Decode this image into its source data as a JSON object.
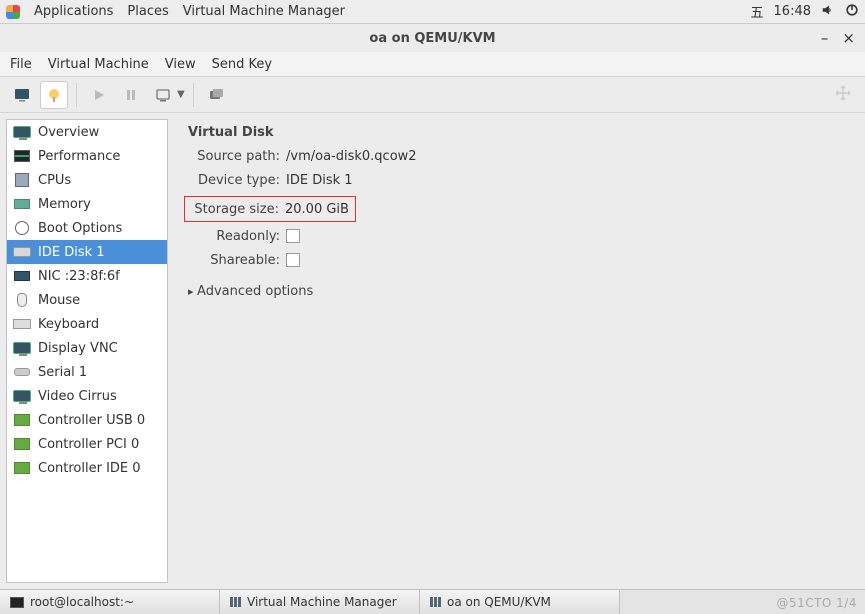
{
  "topbar": {
    "applications": "Applications",
    "places": "Places",
    "app_name": "Virtual Machine Manager",
    "day": "五",
    "time": "16:48"
  },
  "titlebar": {
    "title": "oa on QEMU/KVM"
  },
  "menubar": {
    "file": "File",
    "virtual_machine": "Virtual Machine",
    "view": "View",
    "send_key": "Send Key"
  },
  "sidebar": {
    "items": [
      {
        "label": "Overview",
        "icon": "monitor"
      },
      {
        "label": "Performance",
        "icon": "perf"
      },
      {
        "label": "CPUs",
        "icon": "cpu"
      },
      {
        "label": "Memory",
        "icon": "mem"
      },
      {
        "label": "Boot Options",
        "icon": "boot"
      },
      {
        "label": "IDE Disk 1",
        "icon": "disk",
        "selected": true
      },
      {
        "label": "NIC :23:8f:6f",
        "icon": "nic"
      },
      {
        "label": "Mouse",
        "icon": "mouse"
      },
      {
        "label": "Keyboard",
        "icon": "kbd"
      },
      {
        "label": "Display VNC",
        "icon": "monitor"
      },
      {
        "label": "Serial 1",
        "icon": "serial"
      },
      {
        "label": "Video Cirrus",
        "icon": "monitor"
      },
      {
        "label": "Controller USB 0",
        "icon": "ctrl"
      },
      {
        "label": "Controller PCI 0",
        "icon": "ctrl"
      },
      {
        "label": "Controller IDE 0",
        "icon": "ctrl"
      }
    ]
  },
  "details": {
    "heading": "Virtual Disk",
    "source_path_label": "Source path:",
    "source_path_value": "/vm/oa-disk0.qcow2",
    "device_type_label": "Device type:",
    "device_type_value": "IDE Disk 1",
    "storage_size_label": "Storage size:",
    "storage_size_value": "20.00 GiB",
    "readonly_label": "Readonly:",
    "shareable_label": "Shareable:",
    "advanced": "Advanced options"
  },
  "taskbar": {
    "term": "root@localhost:~",
    "vmm": "Virtual Machine Manager",
    "win": "oa on QEMU/KVM"
  },
  "watermark": "@51CTO  1/4"
}
